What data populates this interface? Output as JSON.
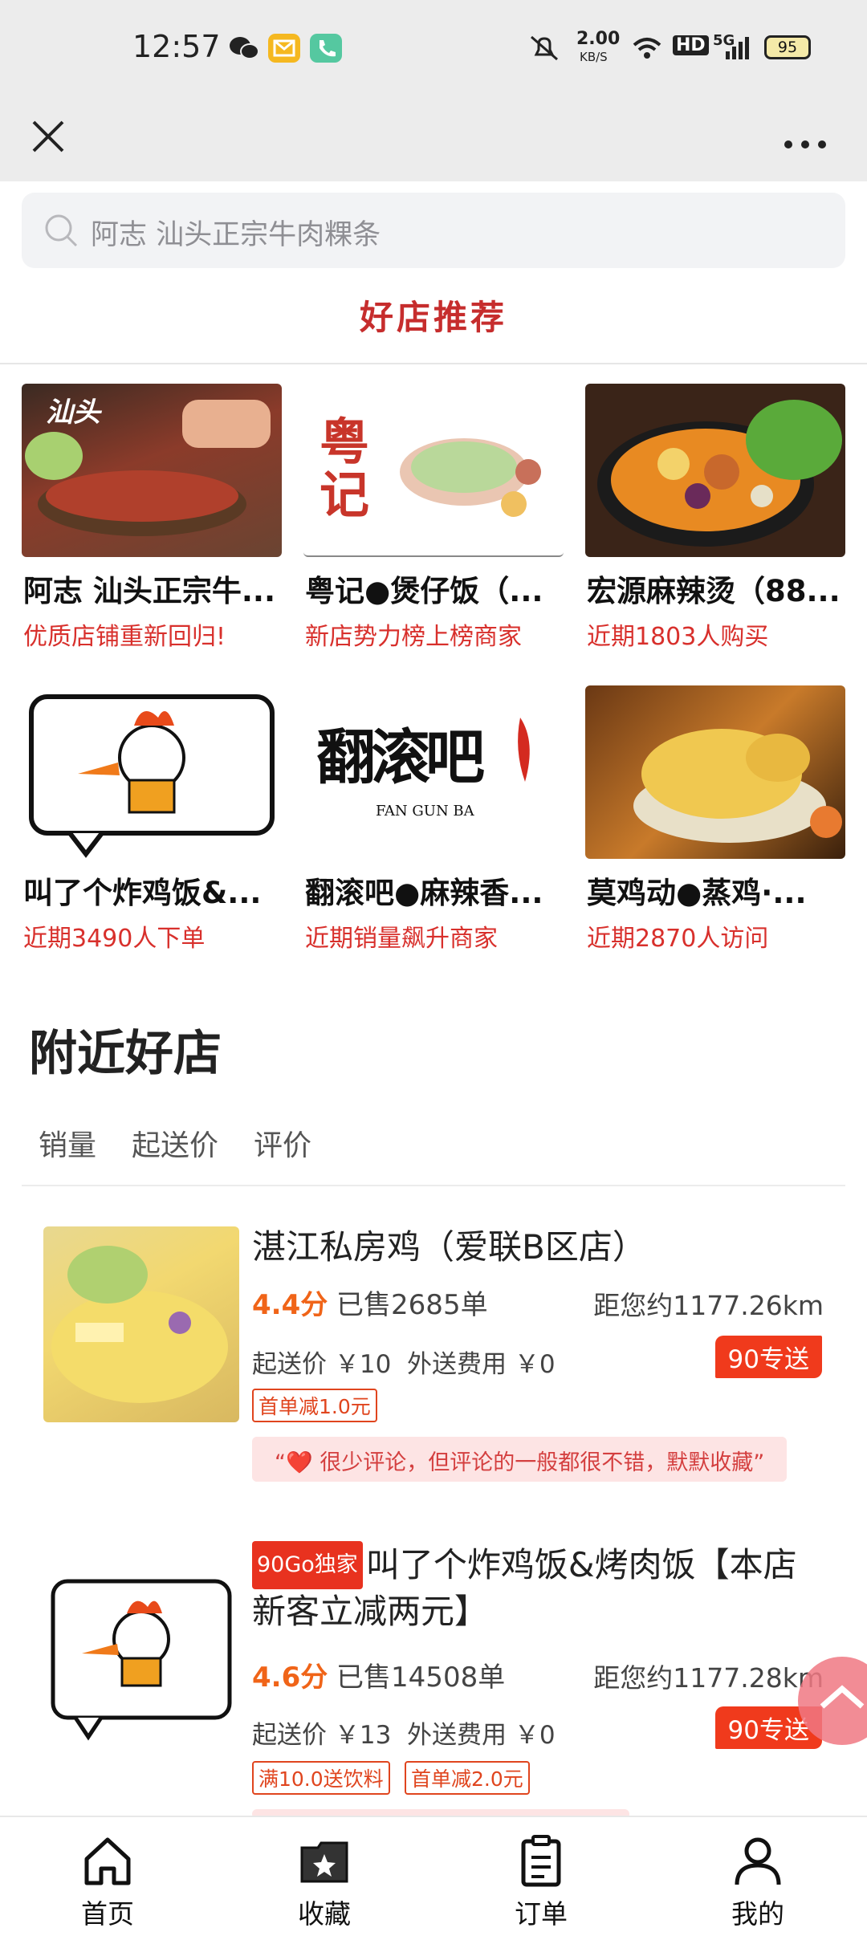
{
  "status_bar": {
    "time": "12:57",
    "net_speed": "2.00",
    "net_unit": "KB/S",
    "hd": "HD",
    "signal": "5G",
    "battery": "95"
  },
  "search": {
    "placeholder": "阿志 汕头正宗牛肉粿条"
  },
  "section_title": "好店推荐",
  "recommended": [
    {
      "name": "阿志 汕头正宗牛...",
      "tag": "优质店铺重新回归!",
      "img_text": "汕头"
    },
    {
      "name": "粤记●煲仔饭（...",
      "tag": "新店势力榜上榜商家",
      "img_text": "粤记"
    },
    {
      "name": "宏源麻辣烫（88...",
      "tag": "近期1803人购买",
      "img_text": ""
    },
    {
      "name": "叫了个炸鸡饭&...",
      "tag": "近期3490人下单",
      "img_text": ""
    },
    {
      "name": "翻滚吧●麻辣香...",
      "tag": "近期销量飙升商家",
      "img_text": "翻滚吧",
      "img_sub": "FAN GUN BA"
    },
    {
      "name": "莫鸡动●蒸鸡·...",
      "tag": "近期2870人访问",
      "img_text": ""
    }
  ],
  "nearby_title": "附近好店",
  "sort_tabs": [
    "销量",
    "起送价",
    "评价"
  ],
  "shops": [
    {
      "name": "湛江私房鸡（爱联B区店）",
      "exclusive": "",
      "score": "4.4分",
      "sold": "已售2685单",
      "distance": "距您约1177.26km",
      "min_order": "起送价 ￥10",
      "delivery_fee": "外送费用 ￥0",
      "delivery_badge": "90专送",
      "promos": [
        "首单减1.0元"
      ],
      "review": "“❤️ 很少评论，但评论的一般都很不错，默默收藏”"
    },
    {
      "name": "叫了个炸鸡饭&烤肉饭【本店新客立减两元】",
      "exclusive": "90Go独家",
      "score": "4.6分",
      "sold": "已售14508单",
      "distance": "距您约1177.28km",
      "min_order": "起送价 ￥13",
      "delivery_fee": "外送费用 ￥0",
      "delivery_badge": "90专送",
      "promos": [
        "满10.0送饮料",
        "首单减2.0元"
      ],
      "review": ""
    }
  ],
  "bottom_nav": [
    {
      "label": "首页",
      "icon": "home-icon"
    },
    {
      "label": "收藏",
      "icon": "favorites-icon"
    },
    {
      "label": "订单",
      "icon": "orders-icon"
    },
    {
      "label": "我的",
      "icon": "profile-icon"
    }
  ],
  "colors": {
    "accent": "#d8302c",
    "score": "#f06418",
    "badge": "#f03a1c"
  }
}
